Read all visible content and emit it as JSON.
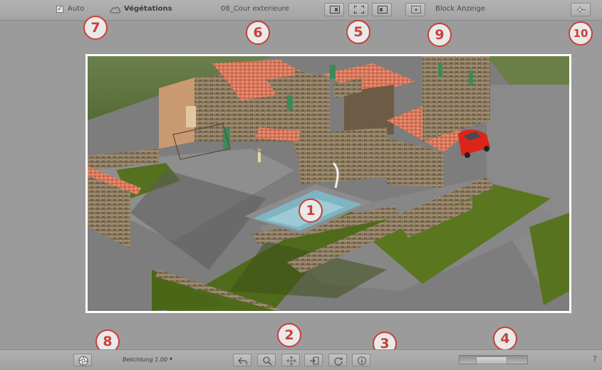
{
  "topbar": {
    "auto_checked": "✓",
    "auto_label": "Auto",
    "vegetation_label": "Végétations",
    "scene_name": "08_Cour exterieure",
    "block_label": "Block Anzeige"
  },
  "bottombar": {
    "exposure_label": "Belichtung 1.00",
    "exposure_arrow": "▾",
    "help_label": "?"
  },
  "badges": [
    "1",
    "2",
    "3",
    "4",
    "5",
    "6",
    "7",
    "8",
    "9",
    "10"
  ],
  "icons": {
    "top_buttons": [
      "frame-left-icon",
      "fit-view-icon",
      "frame-right-icon",
      "block-display-icon",
      "light-settings-icon"
    ],
    "bottom_buttons": [
      "aperture-icon",
      "undo-icon",
      "zoom-icon",
      "pan-icon",
      "export-icon",
      "refresh-icon",
      "info-icon"
    ]
  },
  "colors": {
    "badge_border": "#c9403a",
    "viewport_border": "#ffffff",
    "toolbar": "#a8a8a8"
  },
  "viewer": {
    "slider_position": 0.45
  }
}
